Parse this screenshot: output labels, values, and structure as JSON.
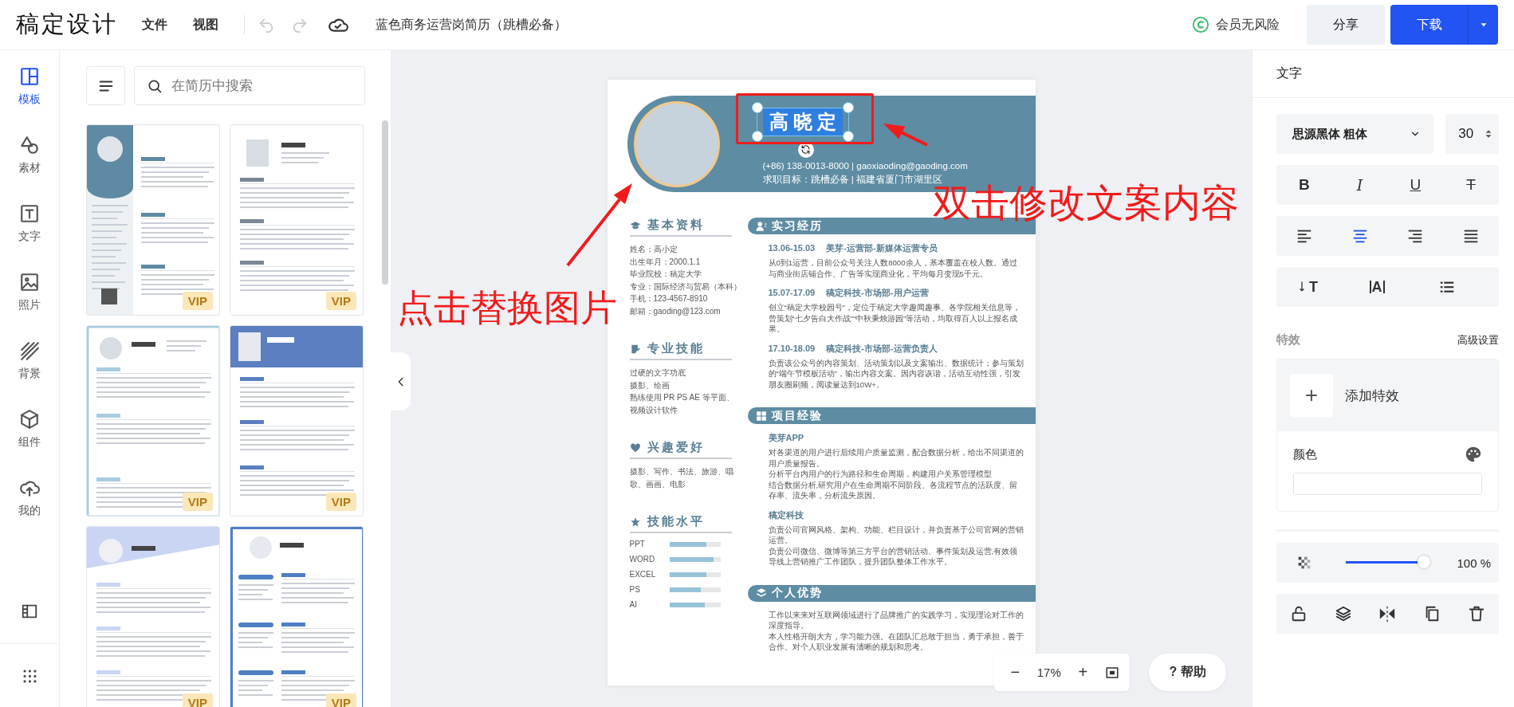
{
  "topbar": {
    "logo": "稿定设计",
    "menus": [
      {
        "label": "文件"
      },
      {
        "label": "视图"
      }
    ],
    "history": [
      {
        "kind": "undo",
        "disabled": true
      },
      {
        "kind": "redo",
        "disabled": true
      }
    ],
    "doc_title": "蓝色商务运营岗简历（跳槽必备）",
    "member": "会员无风险",
    "share": "分享",
    "download": "下载"
  },
  "rail": {
    "items": [
      {
        "kind": "layout",
        "label": "模板",
        "selected": true
      },
      {
        "kind": "shapes",
        "label": "素材",
        "selected": false
      },
      {
        "kind": "text",
        "label": "文字",
        "selected": false
      },
      {
        "kind": "image",
        "label": "照片",
        "selected": false
      },
      {
        "kind": "background",
        "label": "背景",
        "selected": false
      },
      {
        "kind": "cube",
        "label": "组件",
        "selected": false
      },
      {
        "kind": "upload",
        "label": "我的",
        "selected": false
      }
    ],
    "bottom": [
      {
        "kind": "panel"
      },
      {
        "kind": "apps"
      }
    ]
  },
  "templates": {
    "search_placeholder": "在简历中搜索",
    "items": [
      {
        "kind": "sidebar",
        "color": "#5f8aa3",
        "badge": "VIP"
      },
      {
        "kind": "classic",
        "color": "#7a8794",
        "badge": "VIP"
      },
      {
        "kind": "boxed",
        "color": "#a9cde0",
        "badge": "VIP"
      },
      {
        "kind": "banner",
        "color": "#5b7fc0",
        "badge": "VIP"
      },
      {
        "kind": "wave",
        "color": "#c9d5f3",
        "badge": "VIP"
      },
      {
        "kind": "split",
        "color": "#4f7fc4",
        "badge": "VIP"
      }
    ]
  },
  "resume": {
    "name": "高晓定",
    "name_selected": true,
    "contact": "(+86) 138-0013-8000 | gaoxiaoding@gaoding.com",
    "target": "求职目标：跳槽必备 | 福建省厦门市湖里区",
    "left": [
      {
        "kind": "info",
        "title": "基本资料",
        "lines": [
          "姓名：高小定",
          "出生年月：2000.1.1",
          "毕业院校：稿定大学",
          "专业：国际经济与贸易（本科）",
          "手机：123-4567-8910",
          "邮箱：gaoding@123.com"
        ]
      },
      {
        "kind": "skills",
        "title": "专业技能",
        "lines": [
          "过硬的文字功底",
          "摄影、绘画",
          "熟练使用 PR PS AE 等平面、视频设计软件"
        ]
      },
      {
        "kind": "hobby",
        "title": "兴趣爱好",
        "lines": [
          "摄影、写作、书法、旅游、唱歌、画画、电影"
        ]
      },
      {
        "kind": "levels",
        "title": "技能水平",
        "items": [
          {
            "label": "PPT",
            "level": 0.72
          },
          {
            "label": "WORD",
            "level": 0.86
          },
          {
            "label": "EXCEL",
            "level": 0.72
          },
          {
            "label": "PS",
            "level": 0.62
          },
          {
            "label": "AI",
            "level": 0.7
          }
        ]
      }
    ],
    "right": [
      {
        "kind": "work",
        "title": "实习经历",
        "entries": [
          {
            "date": "13.06-15.03",
            "title": "美芽-运营部-新媒体运营专员",
            "paragraphs": [
              "从0到1运营，目前公众号关注人数8000余人，基本覆盖在校人数。通过与商业街店铺合作、广告等实现商业化，平均每月变现5千元。"
            ]
          },
          {
            "date": "15.07-17.09",
            "title": "稿定科技-市场部-用户运营",
            "paragraphs": [
              "创立“稿定大学校园号”，定位于稿定大学趣闻趣事、各学院相关信息等，曾策划“七夕告白大作战”“中秋秉烛游园”等活动，均取得百人以上报名成果。"
            ]
          },
          {
            "date": "17.10-18.09",
            "title": "稿定科技-市场部-运营负责人",
            "paragraphs": [
              "负责该公众号的内容策划、活动策划以及文案输出、数据统计；参与策划的“端午节模板活动”，输出内容文案。因内容诙谐，活动互动性强，引发朋友圈刷频，阅读量达到10W+。"
            ]
          }
        ]
      },
      {
        "kind": "project",
        "title": "项目经验",
        "entries": [
          {
            "title": "美芽APP",
            "paragraphs": [
              "对各渠道的用户进行后续用户质量监测，配合数据分析，给出不同渠道的用户质量报告。",
              "分析平台内用户的行为路径和生命周期，构建用户关系管理模型",
              "结合数据分析,研究用户在生命周期不同阶段、各流程节点的活跃度、留存率、流失率，分析流失原因。"
            ]
          },
          {
            "title": "稿定科技",
            "paragraphs": [
              "负责公司官网风格、架构、功能、栏目设计，并负责基于公司官网的营销运营。",
              "负责公司微信、微博等第三方平台的营销活动、事件策划及运营,有效领导线上营销推广工作团队，提升团队整体工作水平。"
            ]
          }
        ]
      },
      {
        "kind": "strength",
        "title": "个人优势",
        "entries": [
          {
            "paragraphs": [
              "工作以来来对互联网领域进行了品牌推广的实践学习，实现理论对工作的深度指导。",
              "本人性格开朗大方，学习能力强。在团队汇总敢于担当，勇于承担，善于合作。对个人职业发展有清晰的规划和思考。"
            ]
          }
        ]
      }
    ]
  },
  "annotations": [
    {
      "kind": "photo",
      "text": "点击替换图片"
    },
    {
      "kind": "name",
      "text": "双击修改文案内容"
    }
  ],
  "zoom": {
    "minus": "−",
    "reading": "17%",
    "plus": "+"
  },
  "help": {
    "icon": "?",
    "label": "帮助"
  },
  "props": {
    "title": "文字",
    "font": "思源黑体 粗体",
    "size": "30",
    "styles": [
      {
        "kind": "bold",
        "glyph": "B",
        "selected": false
      },
      {
        "kind": "italic",
        "glyph": "I",
        "selected": false
      },
      {
        "kind": "underline",
        "glyph": "U",
        "selected": false
      },
      {
        "kind": "strike",
        "glyph": "T",
        "selected": false
      }
    ],
    "align": [
      {
        "kind": "left",
        "selected": false
      },
      {
        "kind": "center",
        "selected": true
      },
      {
        "kind": "right",
        "selected": false
      },
      {
        "kind": "justify",
        "selected": false
      }
    ],
    "tools": [
      {
        "kind": "vertical",
        "glyph": "T"
      },
      {
        "kind": "spacing",
        "glyph": "A"
      },
      {
        "kind": "list"
      }
    ],
    "effects_label": "特效",
    "advanced": "高级设置",
    "add_effect_icon": "+",
    "add_effect": "添加特效",
    "color_label": "颜色",
    "opacity": {
      "level": 1,
      "reading": "100 %"
    },
    "actions": [
      {
        "kind": "unlock"
      },
      {
        "kind": "layers"
      },
      {
        "kind": "flip"
      },
      {
        "kind": "copy"
      },
      {
        "kind": "delete"
      }
    ]
  }
}
